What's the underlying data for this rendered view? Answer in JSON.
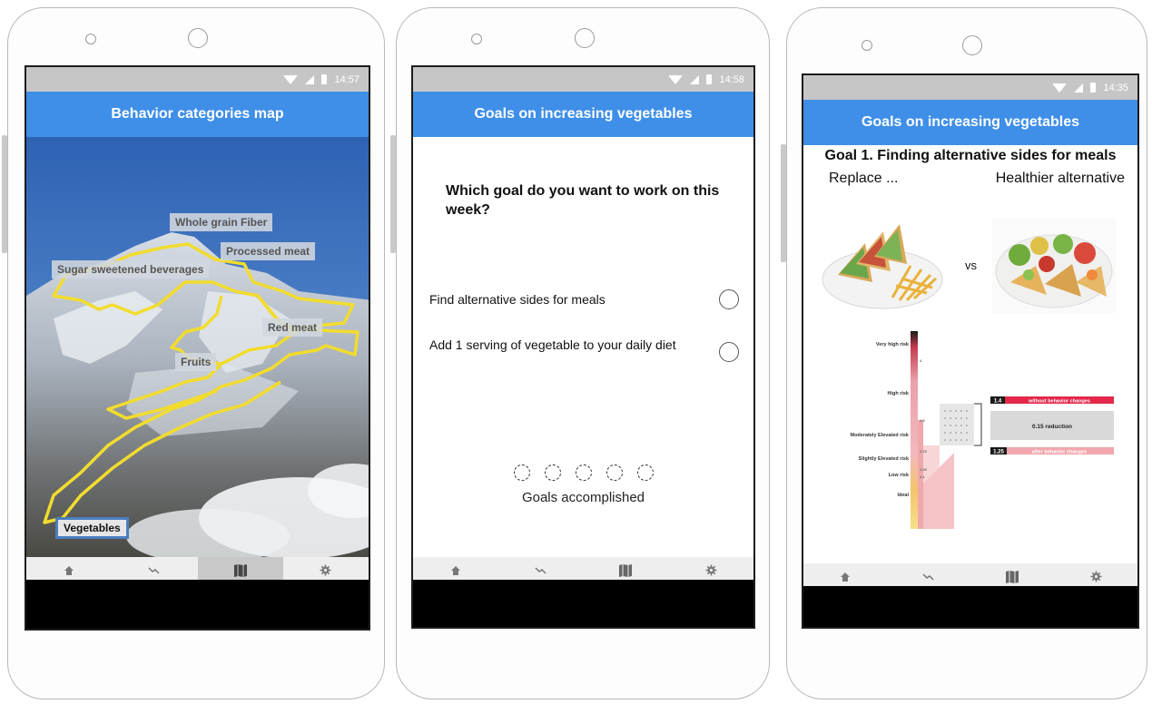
{
  "phones": [
    {
      "status": {
        "time": "14:57",
        "wifi_icon": "wifi-icon",
        "signal_icon": "signal-icon",
        "battery_icon": "battery-icon"
      },
      "appbar_title": "Behavior categories map",
      "map_labels": {
        "whole_grain": "Whole grain Fiber",
        "processed_meat": "Processed meat",
        "sugar": "Sugar sweetened beverages",
        "red_meat": "Red meat",
        "fruits": "Fruits",
        "vegetables": "Vegetables"
      },
      "bottom_nav": [
        {
          "icon": "home-icon",
          "active": false
        },
        {
          "icon": "trend-icon",
          "active": false
        },
        {
          "icon": "map-icon",
          "active": true
        },
        {
          "icon": "gear-icon",
          "active": false
        }
      ]
    },
    {
      "status": {
        "time": "14:58"
      },
      "appbar_title": "Goals on increasing vegetables",
      "question": "Which goal do you want to work on this week?",
      "options": [
        {
          "label": "Find alternative sides for meals",
          "selected": false
        },
        {
          "label": "Add 1 serving of vegetable to your daily diet",
          "selected": false
        }
      ],
      "goals_accomplished_count": 0,
      "goals_total": 5,
      "goals_label": "Goals accomplished",
      "bottom_nav": [
        {
          "icon": "home-icon"
        },
        {
          "icon": "trend-icon"
        },
        {
          "icon": "map-icon"
        },
        {
          "icon": "gear-icon"
        }
      ]
    },
    {
      "status": {
        "time": "14:35"
      },
      "appbar_title": "Goals on increasing vegetables",
      "goal_title": "Goal 1. Finding alternative sides for meals",
      "replace_label": "Replace ...",
      "alternative_label": "Healthier alternative",
      "vs_label": "vs",
      "risk_chart": {
        "levels": [
          "Very high risk",
          "High risk",
          "Moderately Elevated risk",
          "Slightly Elevated risk",
          "Low risk",
          "Ideal"
        ],
        "ticks": [
          "4",
          "2.5",
          "1.75",
          "1.25",
          "1.1"
        ],
        "without_value": "1.4",
        "without_label": "without behavior changes",
        "reduction_label": "0.15 reduction",
        "after_value": "1.25",
        "after_label": "after behavior changes"
      },
      "bottom_nav": [
        {
          "icon": "home-icon"
        },
        {
          "icon": "trend-icon"
        },
        {
          "icon": "map-icon"
        },
        {
          "icon": "gear-icon"
        }
      ]
    }
  ],
  "colors": {
    "appbar": "#3f8fe8",
    "statusbar": "#c6c6c6",
    "trail": "#f2dc2e",
    "risk_red": "#e3284a",
    "risk_pink": "#f1a7ad"
  }
}
